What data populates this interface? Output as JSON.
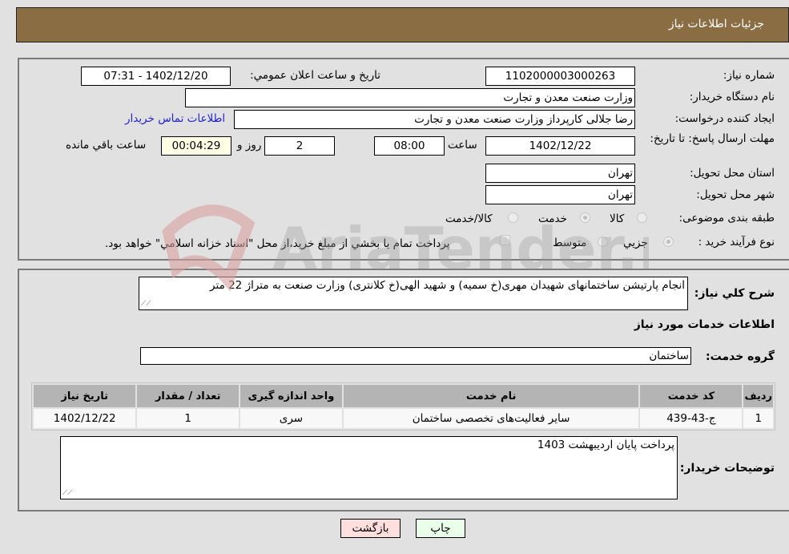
{
  "header": {
    "title": "جزئیات اطلاعات نیاز"
  },
  "form": {
    "need_number": {
      "label": "شماره نیاز:",
      "value": "1102000003000263"
    },
    "announce_datetime": {
      "label": "تاریخ و ساعت اعلان عمومي:",
      "value": "1402/12/20 - 07:31"
    },
    "buyer_org": {
      "label": "نام دستگاه خريدار:",
      "value": "وزارت صنعت معدن و تجارت"
    },
    "requester": {
      "label": "ایجاد کننده درخواست:",
      "value": "رضا جلالی کارپرداز وزارت صنعت معدن و تجارت",
      "contact_link": "اطلاعات تماس خریدار"
    },
    "deadline": {
      "label": "مهلت ارسال پاسخ: تا تاریخ:",
      "date": "1402/12/22",
      "time_label": "ساعت",
      "time": "08:00",
      "days": "2",
      "days_label": "روز و",
      "remaining": "00:04:29",
      "remaining_label": "ساعت باقي مانده"
    },
    "province": {
      "label": "استان محل تحویل:",
      "value": "تهران"
    },
    "city": {
      "label": "شهر محل تحویل:",
      "value": "تهران"
    },
    "category": {
      "label": "طبقه بندی موضوعی:",
      "options": [
        {
          "label": "کالا",
          "checked": false
        },
        {
          "label": "خدمت",
          "checked": true
        },
        {
          "label": "کالا/خدمت",
          "checked": false
        }
      ]
    },
    "process": {
      "label": "نوع فرآیند خرید :",
      "options": [
        {
          "label": "جزيي",
          "checked": true
        },
        {
          "label": "متوسط",
          "checked": false
        }
      ],
      "treasury_note": "پرداخت تمام يا بخشي از مبلغ خريد،از محل \"اسناد خزانه اسلامي\" خواهد بود."
    }
  },
  "description": {
    "label": "شرح کلي نياز:",
    "value": "انجام پارتیشن ساختمانهای شهیدان مهری(خ سمیه) و شهید الهی(خ کلانتری) وزارت صنعت به متراژ 22 متر"
  },
  "services": {
    "section_title": "اطلاعات خدمات مورد نياز",
    "group_label": "گروه خدمت:",
    "group_value": "ساختمان",
    "columns": [
      "ردیف",
      "کد خدمت",
      "نام خدمت",
      "واحد اندازه گیری",
      "تعداد / مقدار",
      "تاریخ نیاز"
    ],
    "rows": [
      [
        "1",
        "ج-43-439",
        "سایر فعالیت‌های تخصصی ساختمان",
        "سری",
        "1",
        "1402/12/22"
      ]
    ]
  },
  "buyer_notes": {
    "label": "توضیحات خریدار:",
    "value": "پرداخت پایان اردیبهشت 1403"
  },
  "buttons": {
    "print": "چاپ",
    "back": "بازگشت"
  },
  "watermark": {
    "text": "AriaTender.neT"
  },
  "colors": {
    "header_bg": "#8b6d43",
    "link": "#2222cc",
    "print_bg": "#eaffea",
    "back_bg": "#ffdede",
    "remaining_bg": "#ffffe6"
  }
}
